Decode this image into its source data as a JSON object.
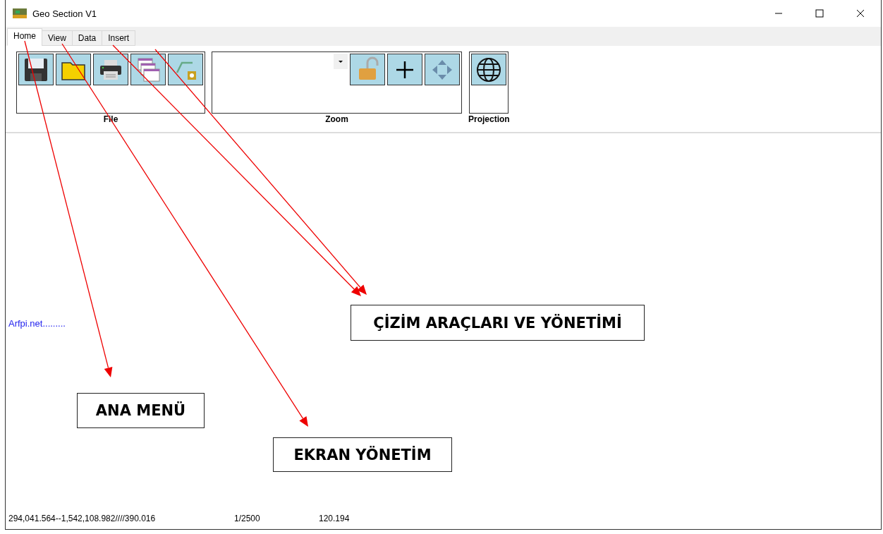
{
  "window": {
    "title": "Geo Section V1"
  },
  "tabs": [
    {
      "label": "Home",
      "selected": true
    },
    {
      "label": "View",
      "selected": false
    },
    {
      "label": "Data",
      "selected": false
    },
    {
      "label": "Insert",
      "selected": false
    }
  ],
  "ribbon": {
    "groups": [
      {
        "label": "File",
        "controls": [
          {
            "kind": "save"
          },
          {
            "kind": "folder"
          },
          {
            "kind": "printer"
          },
          {
            "kind": "tables"
          },
          {
            "kind": "line-star"
          }
        ]
      },
      {
        "label": "Zoom",
        "controls": [
          {
            "kind": "dropdown"
          },
          {
            "kind": "lock"
          },
          {
            "kind": "plus"
          },
          {
            "kind": "move"
          }
        ]
      },
      {
        "label": "Projection",
        "controls": [
          {
            "kind": "globe"
          }
        ]
      }
    ]
  },
  "canvas": {
    "link": "Arfpi.net........."
  },
  "status_bar": [
    "294,041.564--1,542,108.982////390.016",
    "1/2500",
    "120.194"
  ],
  "annotations": [
    {
      "label": "ÇİZİM ARAÇLARI VE YÖNETİMİ"
    },
    {
      "label": "ANA MENÜ"
    },
    {
      "label": "EKRAN YÖNETİM"
    }
  ]
}
